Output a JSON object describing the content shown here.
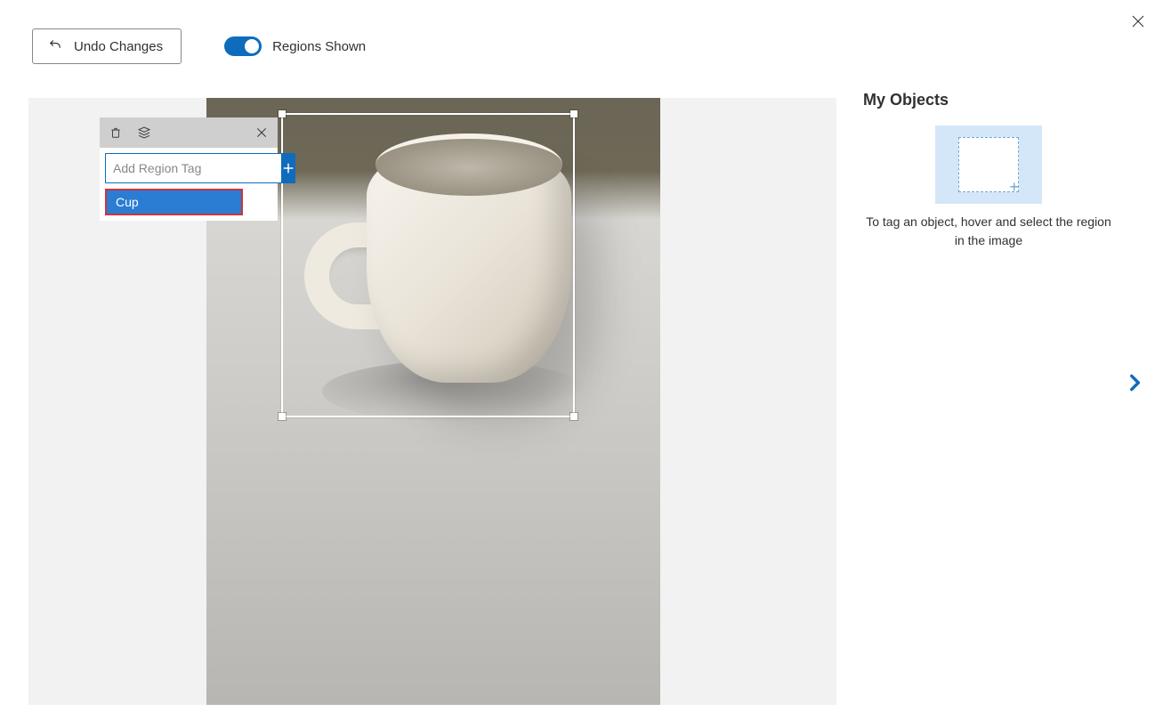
{
  "toolbar": {
    "undo_label": "Undo Changes",
    "toggle_label": "Regions Shown"
  },
  "tag_popup": {
    "input_placeholder": "Add Region Tag",
    "suggestion": "Cup"
  },
  "side": {
    "title": "My Objects",
    "help": "To tag an object, hover and select the region in the image"
  }
}
